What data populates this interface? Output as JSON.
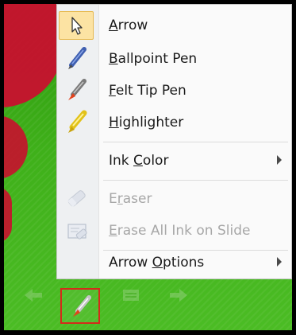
{
  "menu": {
    "items": [
      {
        "label": "Arrow",
        "mnemonic": "A",
        "rest": "rrow",
        "icon": "arrow-pointer-icon",
        "state": "selected"
      },
      {
        "label": "Ballpoint Pen",
        "mnemonic": "B",
        "rest": "allpoint Pen",
        "icon": "ballpoint-pen-icon",
        "state": "enabled"
      },
      {
        "label": "Felt Tip Pen",
        "mnemonic": "F",
        "rest": "elt Tip Pen",
        "icon": "felt-tip-pen-icon",
        "state": "enabled"
      },
      {
        "label": "Highlighter",
        "mnemonic": "H",
        "rest": "ighlighter",
        "icon": "highlighter-icon",
        "state": "enabled"
      },
      {
        "label": "Ink Color",
        "pre": "Ink ",
        "mnemonic": "C",
        "rest": "olor",
        "submenu": true,
        "state": "enabled"
      },
      {
        "label": "Eraser",
        "pre": "E",
        "mnemonic": "r",
        "rest": "aser",
        "icon": "eraser-icon",
        "state": "disabled"
      },
      {
        "label": "Erase All Ink on Slide",
        "mnemonic": "E",
        "rest": "rase All Ink on Slide",
        "icon": "erase-all-ink-icon",
        "state": "disabled"
      },
      {
        "label": "Arrow Options",
        "pre": "Arrow ",
        "mnemonic": "O",
        "rest": "ptions",
        "submenu": true,
        "state": "enabled"
      }
    ]
  },
  "toolbar": {
    "buttons": [
      "previous-slide-icon",
      "pen-icon",
      "menu-icon",
      "next-slide-icon"
    ],
    "active": "pen-icon"
  },
  "colors": {
    "slide_green": "#3fb01a",
    "accent_red": "#c8102e",
    "highlight_fill": "#fce3a3",
    "highlight_border": "#e7b94f",
    "pen_button_border": "#d42b1a"
  }
}
